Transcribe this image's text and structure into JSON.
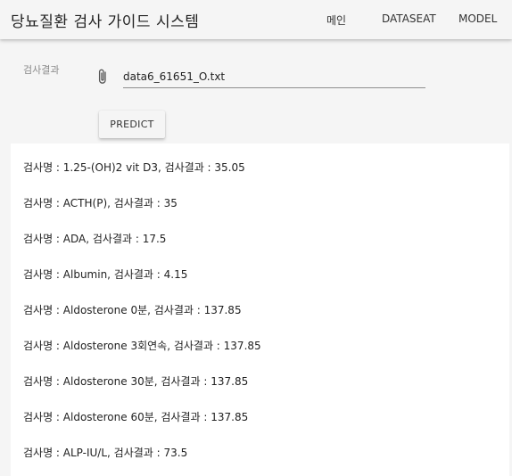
{
  "header": {
    "title": "당뇨질환 검사 가이드 시스템",
    "nav": [
      "메인",
      "DATASEAT",
      "MODEL"
    ]
  },
  "form": {
    "label": "검사결과",
    "file_value": "data6_61651_O.txt",
    "attach_icon": "paperclip-icon",
    "predict_label": "PREDICT"
  },
  "results": [
    "검사명 : 1.25-(OH)2 vit D3, 검사결과 : 35.05",
    "검사명 : ACTH(P), 검사결과 : 35",
    "검사명 : ADA, 검사결과 : 17.5",
    "검사명 : Albumin, 검사결과 : 4.15",
    "검사명 : Aldosterone 0분, 검사결과 : 137.85",
    "검사명 : Aldosterone 3회연속, 검사결과 : 137.85",
    "검사명 : Aldosterone 30분, 검사결과 : 137.85",
    "검사명 : Aldosterone 60분, 검사결과 : 137.85",
    "검사명 : ALP-IU/L, 검사결과 : 73.5"
  ]
}
